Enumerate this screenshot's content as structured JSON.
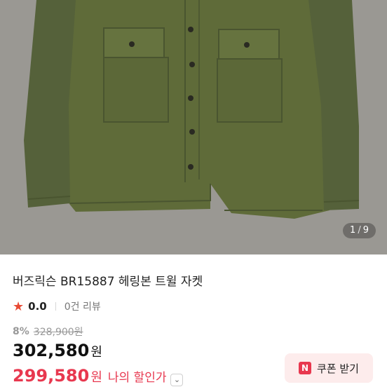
{
  "image": {
    "counter_current": "1",
    "counter_separator": "/",
    "counter_total": "9"
  },
  "product": {
    "title": "버즈릭슨 BR15887 헤링본 트윌 자켓",
    "rating": "0.0",
    "review_count": "0건 리뷰",
    "discount_rate": "8%",
    "original_price": "328,900원",
    "price": "302,580",
    "price_unit": "원",
    "my_price": "299,580",
    "my_price_unit": "원",
    "my_price_label": "나의 할인가"
  },
  "coupon": {
    "logo_letter": "N",
    "label": "쿠폰 받기"
  },
  "colors": {
    "accent": "#e8384f",
    "star": "#e84a35",
    "coupon_bg": "#fdecec",
    "jacket": "#5f6b39"
  },
  "icons": {
    "star": "star-icon",
    "chevron": "chevron-down-icon",
    "coupon_logo": "naver-n-icon"
  }
}
